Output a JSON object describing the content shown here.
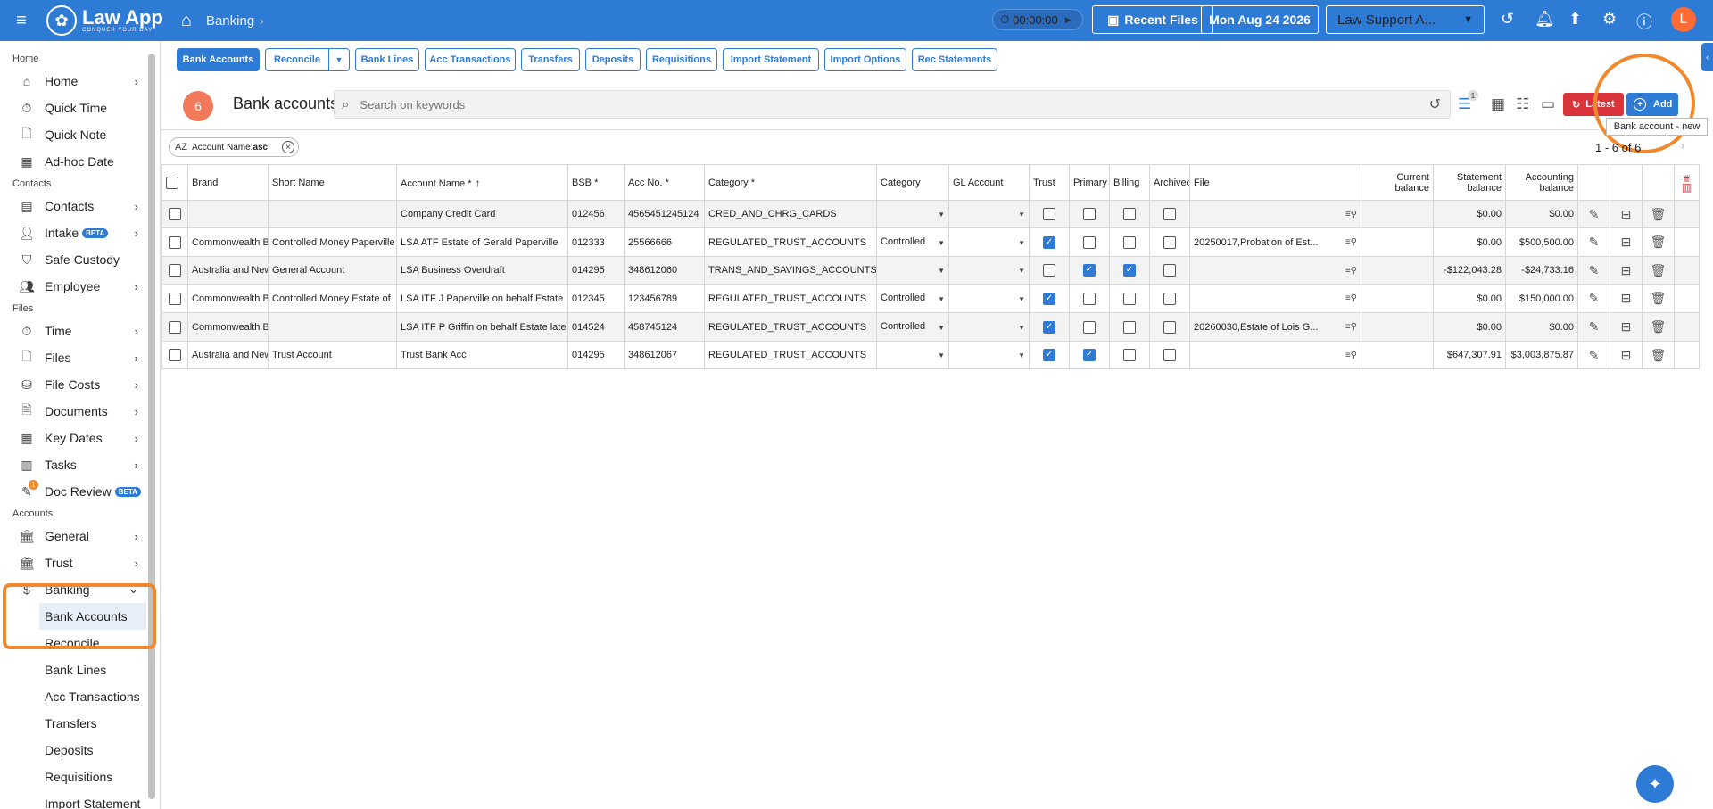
{
  "header": {
    "logo_name": "Law App",
    "logo_tagline": "CONQUER YOUR DAY",
    "breadcrumb": "Banking",
    "timer": "00:00:00",
    "recent_files": "Recent Files",
    "date": "Mon Aug 24 2026",
    "workspace": "Law Support A...",
    "avatar_initial": "L",
    "accent": "#2e7bd6"
  },
  "sidebar": {
    "sec_home": "Home",
    "home": "Home",
    "quick_time": "Quick Time",
    "quick_note": "Quick Note",
    "adhoc_date": "Ad-hoc Date",
    "sec_contacts": "Contacts",
    "contacts": "Contacts",
    "intake": "Intake",
    "beta": "BETA",
    "safe_custody": "Safe Custody",
    "employee": "Employee",
    "sec_files": "Files",
    "time": "Time",
    "files": "Files",
    "file_costs": "File Costs",
    "documents": "Documents",
    "key_dates": "Key Dates",
    "tasks": "Tasks",
    "doc_review": "Doc Review",
    "doc_review_badge": "1",
    "sec_accounts": "Accounts",
    "general": "General",
    "trust": "Trust",
    "banking": "Banking",
    "sub": [
      "Bank Accounts",
      "Reconcile",
      "Bank Lines",
      "Acc Transactions",
      "Transfers",
      "Deposits",
      "Requisitions",
      "Import Statement"
    ]
  },
  "tabs": {
    "bank_accounts": "Bank Accounts",
    "reconcile": "Reconcile",
    "bank_lines": "Bank Lines",
    "acc_transactions": "Acc Transactions",
    "transfers": "Transfers",
    "deposits": "Deposits",
    "requisitions": "Requisitions",
    "import_statement": "Import Statement",
    "import_options": "Import Options",
    "rec_statements": "Rec Statements"
  },
  "panel": {
    "count": "6",
    "title": "Bank accounts",
    "search_placeholder": "Search on keywords",
    "filter_badge": "1",
    "latest": "Latest",
    "add": "Add",
    "tooltip": "Bank account - new",
    "chip_label": "Account Name:",
    "chip_value": "asc",
    "pager": "1 - 6 of 6"
  },
  "table": {
    "headers": {
      "brand": "Brand",
      "short_name": "Short Name",
      "account_name": "Account Name *",
      "bsb": "BSB *",
      "acc_no": "Acc No. *",
      "category_req": "Category *",
      "category": "Category",
      "gl_account": "GL Account",
      "trust": "Trust",
      "primary": "Primary",
      "billing": "Billing",
      "archived": "Archived",
      "file": "File",
      "current_1": "Current",
      "current_2": "balance",
      "statement_1": "Statement",
      "statement_2": "balance",
      "accounting_1": "Accounting",
      "accounting_2": "balance"
    },
    "rows": [
      {
        "brand": "",
        "short": "",
        "name": "Company Credit Card",
        "bsb": "012456",
        "acc": "4565451245124",
        "cat": "CRED_AND_CHRG_CARDS",
        "cat2": "",
        "trust": false,
        "primary": false,
        "billing": false,
        "archived": false,
        "file": "",
        "current": "",
        "statement": "$0.00",
        "accounting": "$0.00"
      },
      {
        "brand": "Commonwealth B",
        "short": "Controlled Money Paperville",
        "name": "LSA ATF Estate of Gerald Paperville",
        "bsb": "012333",
        "acc": "25566666",
        "cat": "REGULATED_TRUST_ACCOUNTS",
        "cat2": "Controlled",
        "trust": true,
        "primary": false,
        "billing": false,
        "archived": false,
        "file": "20250017,Probation of Est...",
        "current": "",
        "statement": "$0.00",
        "accounting": "$500,500.00"
      },
      {
        "brand": "Australia and New",
        "short": "General Account",
        "name": "LSA Business Overdraft",
        "bsb": "014295",
        "acc": "348612060",
        "cat": "TRANS_AND_SAVINGS_ACCOUNTS",
        "cat2": "",
        "trust": false,
        "primary": true,
        "billing": true,
        "archived": false,
        "file": "",
        "current": "",
        "statement": "-$122,043.28",
        "accounting": "-$24,733.16"
      },
      {
        "brand": "Commonwealth B",
        "short": "Controlled Money Estate of",
        "name": "LSA ITF J Paperville on behalf Estate",
        "bsb": "012345",
        "acc": "123456789",
        "cat": "REGULATED_TRUST_ACCOUNTS",
        "cat2": "Controlled",
        "trust": true,
        "primary": false,
        "billing": false,
        "archived": false,
        "file": "",
        "current": "",
        "statement": "$0.00",
        "accounting": "$150,000.00"
      },
      {
        "brand": "Commonwealth B",
        "short": "",
        "name": "LSA ITF P Griffin on behalf Estate late",
        "bsb": "014524",
        "acc": "458745124",
        "cat": "REGULATED_TRUST_ACCOUNTS",
        "cat2": "Controlled",
        "trust": true,
        "primary": false,
        "billing": false,
        "archived": false,
        "file": "20260030,Estate of Lois G...",
        "current": "",
        "statement": "$0.00",
        "accounting": "$0.00"
      },
      {
        "brand": "Australia and New",
        "short": "Trust Account",
        "name": "Trust Bank Acc",
        "bsb": "014295",
        "acc": "348612067",
        "cat": "REGULATED_TRUST_ACCOUNTS",
        "cat2": "",
        "trust": true,
        "primary": true,
        "billing": false,
        "archived": false,
        "file": "",
        "current": "",
        "statement": "$647,307.91",
        "accounting": "$3,003,875.87"
      }
    ]
  }
}
